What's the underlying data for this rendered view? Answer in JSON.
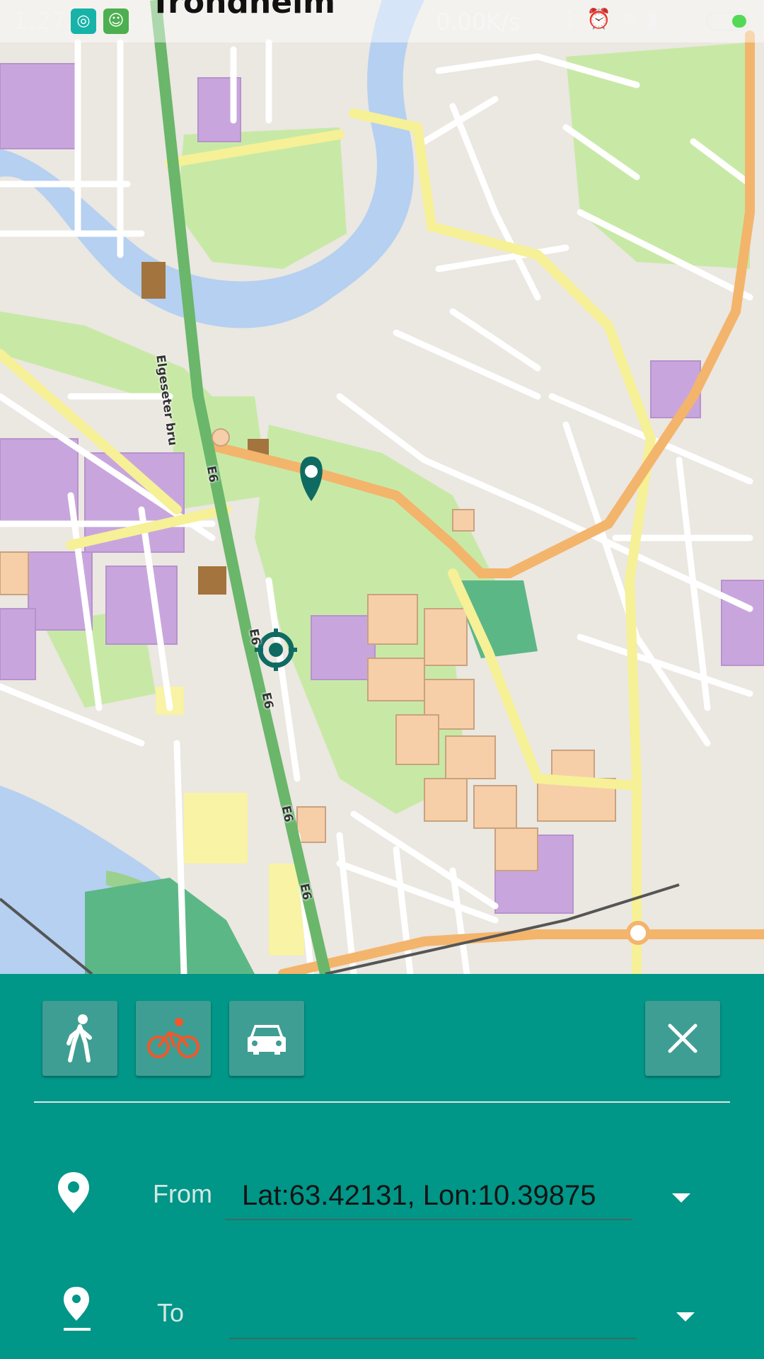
{
  "status_bar": {
    "time": "1:27",
    "app_icons": [
      "notification-app-icon",
      "android-app-icon"
    ],
    "city": "Trondheim",
    "net_speed": "0.00K/s",
    "system_icons": [
      "nfc-icon",
      "bluetooth-icon",
      "alarm-icon",
      "wifi-icon",
      "signal-icon"
    ],
    "battery_color": "#54d957"
  },
  "map": {
    "bridge_label": "Elgeseter bru",
    "road_labels": [
      "E6",
      "E6",
      "E6",
      "E6",
      "E6"
    ],
    "colors": {
      "water": "#b5d0f0",
      "park": "#c8e9a6",
      "building_purple": "#c8a6dd",
      "building_orange": "#f6cfa8",
      "highway": "#6ab66a",
      "primary_road": "#f3b46c",
      "secondary_road": "#f6f097",
      "marker": "#0f6b62"
    }
  },
  "panel": {
    "background": "#009688",
    "modes": [
      {
        "name": "walk",
        "icon": "walk-icon",
        "selected": false
      },
      {
        "name": "bike",
        "icon": "bike-icon",
        "selected": true
      },
      {
        "name": "car",
        "icon": "car-icon",
        "selected": false
      }
    ],
    "close_icon": "close-icon",
    "from": {
      "label": "From",
      "value": "Lat:63.42131, Lon:10.39875"
    },
    "to": {
      "label": "To",
      "value": ""
    },
    "selected_mode_color": "#f1572a"
  }
}
